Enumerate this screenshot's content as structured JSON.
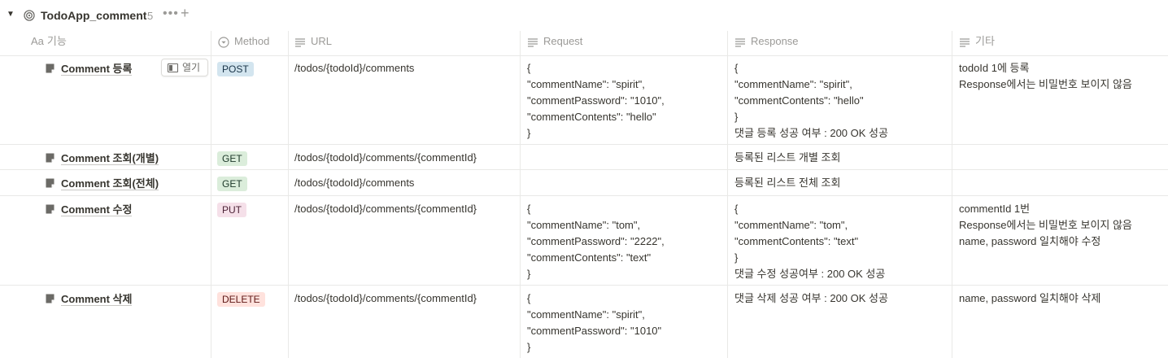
{
  "database": {
    "title": "TodoApp_comment",
    "count": "5"
  },
  "columns": {
    "name": "기능",
    "name_prefix": "Aa",
    "method": "Method",
    "url": "URL",
    "request": "Request",
    "response": "Response",
    "etc": "기타"
  },
  "open_label": "열기",
  "rows": [
    {
      "name": "Comment 등록",
      "method": "POST",
      "url": "/todos/{todoId}/comments",
      "request": "{\n\"commentName\": \"spirit\",\n\"commentPassword\": \"1010\",\n\"commentContents\": \"hello\"\n}",
      "response": "{\n\"commentName\": \"spirit\",\n\"commentContents\": \"hello\"\n}\n댓글 등록 성공 여부 : 200 OK 성공",
      "etc": "todoId 1에 등록\nResponse에서는 비밀번호 보이지 않음"
    },
    {
      "name": "Comment 조회(개별)",
      "method": "GET",
      "url": "/todos/{todoId}/comments/{commentId}",
      "request": "",
      "response": "등록된 리스트 개별 조회",
      "etc": ""
    },
    {
      "name": "Comment 조회(전체)",
      "method": "GET",
      "url": "/todos/{todoId}/comments",
      "request": "",
      "response": "등록된 리스트 전체 조회",
      "etc": ""
    },
    {
      "name": "Comment 수정",
      "method": "PUT",
      "url": "/todos/{todoId}/comments/{commentId}",
      "request": "{\n\"commentName\": \"tom\",\n\"commentPassword\": \"2222\",\n\"commentContents\": \"text\"\n}",
      "response": "{\n\"commentName\": \"tom\",\n\"commentContents\": \"text\"\n}\n댓글 수정 성공여부 : 200 OK 성공",
      "etc": "commentId 1번\nResponse에서는 비밀번호 보이지 않음\nname, password 일치해야 수정"
    },
    {
      "name": "Comment 삭제",
      "method": "DELETE",
      "url": "/todos/{todoId}/comments/{commentId}",
      "request": "{\n\"commentName\": \"spirit\",\n\"commentPassword\": \"1010\"\n}",
      "response": "댓글 삭제 성공 여부 : 200 OK 성공",
      "etc": "name, password 일치해야 삭제"
    }
  ],
  "method_colors": {
    "POST": {
      "bg": "#d3e5ef",
      "fg": "#183347"
    },
    "GET": {
      "bg": "#dbeddb",
      "fg": "#1c3829"
    },
    "PUT": {
      "bg": "#f5e0e9",
      "fg": "#4c2337"
    },
    "DELETE": {
      "bg": "#ffe2dd",
      "fg": "#5d1715"
    }
  }
}
